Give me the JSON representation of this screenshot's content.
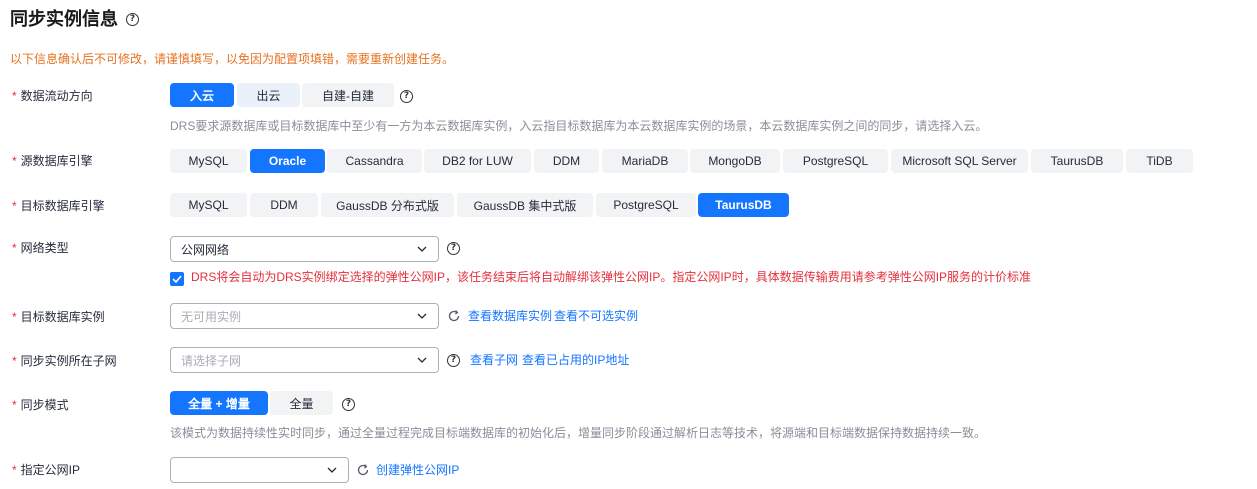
{
  "title": "同步实例信息",
  "notice": "以下信息确认后不可修改，请谨慎填写，以免因为配置项填错，需要重新创建任务。",
  "help_glyph": "?",
  "flow": {
    "label": "数据流动方向",
    "options": [
      "入云",
      "出云",
      "自建-自建"
    ],
    "selected": "入云",
    "hint": "DRS要求源数据库或目标数据库中至少有一方为本云数据库实例，入云指目标数据库为本云数据库实例的场景，本云数据库实例之间的同步，请选择入云。"
  },
  "source_engine": {
    "label": "源数据库引擎",
    "options": [
      "MySQL",
      "Oracle",
      "Cassandra",
      "DB2 for LUW",
      "DDM",
      "MariaDB",
      "MongoDB",
      "PostgreSQL",
      "Microsoft SQL Server",
      "TaurusDB",
      "TiDB"
    ],
    "selected": "Oracle"
  },
  "target_engine": {
    "label": "目标数据库引擎",
    "options": [
      "MySQL",
      "DDM",
      "GaussDB 分布式版",
      "GaussDB 集中式版",
      "PostgreSQL",
      "TaurusDB"
    ],
    "selected": "TaurusDB"
  },
  "network": {
    "label": "网络类型",
    "value": "公网网络",
    "checkbox_checked": true,
    "checkbox_text": "DRS将会自动为DRS实例绑定选择的弹性公网IP，该任务结束后将自动解绑该弹性公网IP。指定公网IP时，具体数据传输费用请参考弹性公网IP服务的计价标准"
  },
  "target_instance": {
    "label": "目标数据库实例",
    "placeholder": "无可用实例",
    "link_view": "查看数据库实例",
    "link_unavailable": "查看不可选实例"
  },
  "subnet": {
    "label": "同步实例所在子网",
    "placeholder": "请选择子网",
    "link_subnet": "查看子网",
    "link_ip": "查看已占用的IP地址"
  },
  "sync_mode": {
    "label": "同步模式",
    "options": [
      "全量 + 增量",
      "全量"
    ],
    "selected": "全量 + 增量",
    "hint": "该模式为数据持续性实时同步，通过全量过程完成目标端数据库的初始化后，增量同步阶段通过解析日志等技术，将源端和目标端数据保持数据持续一致。"
  },
  "public_ip": {
    "label": "指定公网IP",
    "value": "",
    "link_create": "创建弹性公网IP"
  },
  "colors": {
    "accent": "#1476ff",
    "required": "#e3303c",
    "notice": "#e57322",
    "hint": "#8a8e99"
  }
}
